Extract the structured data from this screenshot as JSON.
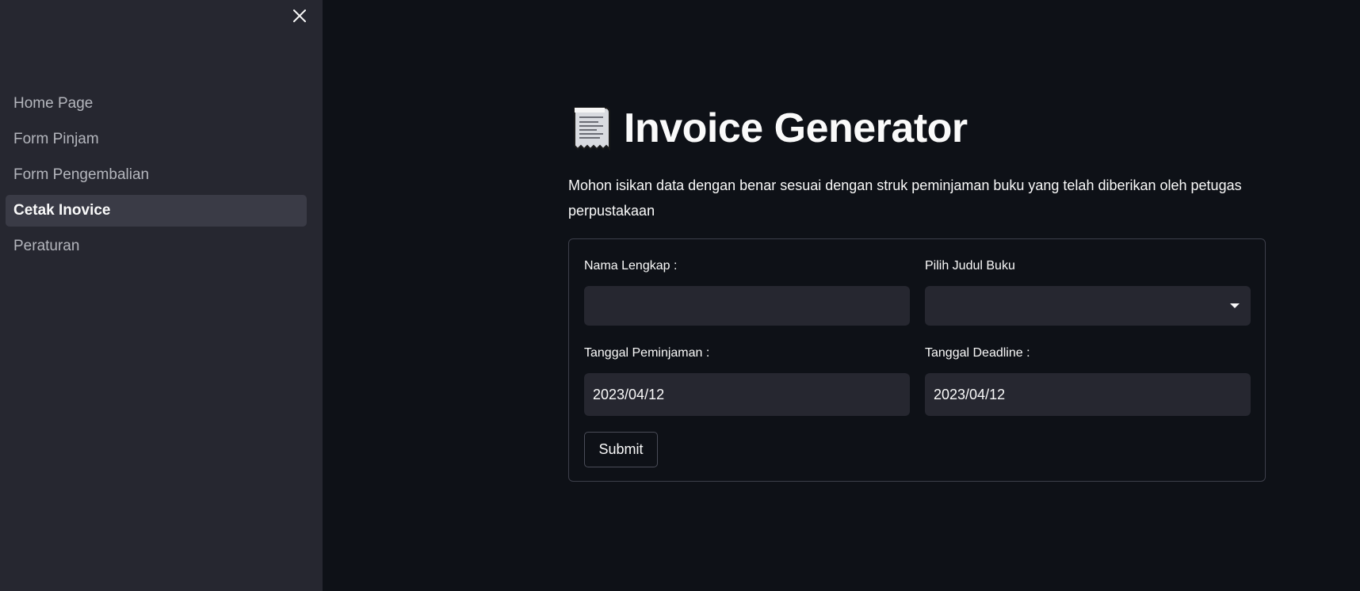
{
  "sidebar": {
    "close_icon": "close-icon",
    "items": [
      {
        "label": "Home Page",
        "active": false
      },
      {
        "label": "Form Pinjam",
        "active": false
      },
      {
        "label": "Form Pengembalian",
        "active": false
      },
      {
        "label": "Cetak Inovice",
        "active": true
      },
      {
        "label": "Peraturan",
        "active": false
      }
    ]
  },
  "main": {
    "title_icon": "receipt-icon",
    "title": "Invoice Generator",
    "description": "Mohon isikan data dengan benar sesuai dengan struk peminjaman buku yang telah diberikan oleh petugas perpustakaan",
    "form": {
      "nama_label": "Nama Lengkap :",
      "nama_value": "",
      "judul_label": "Pilih Judul Buku",
      "judul_value": "",
      "tanggal_pinjam_label": "Tanggal Peminjaman :",
      "tanggal_pinjam_value": "2023/04/12",
      "tanggal_deadline_label": "Tanggal Deadline :",
      "tanggal_deadline_value": "2023/04/12",
      "submit_label": "Submit"
    }
  },
  "colors": {
    "background": "#0e1117",
    "sidebar": "#262730",
    "active_item": "#3a3b46",
    "text": "#fafafa",
    "muted_text": "#b4b6bd"
  }
}
